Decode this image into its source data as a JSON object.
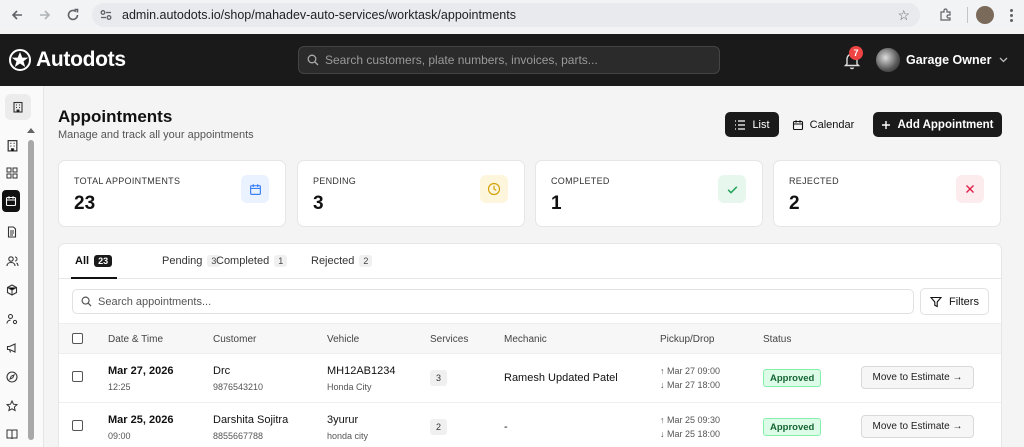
{
  "browser": {
    "url": "admin.autodots.io/shop/mahadev-auto-services/worktask/appointments"
  },
  "header": {
    "brand": "Autodots",
    "search_placeholder": "Search customers, plate numbers, invoices, parts...",
    "notification_count": "7",
    "user_name": "Garage Owner"
  },
  "page": {
    "title": "Appointments",
    "subtitle": "Manage and track all your appointments",
    "view_list": "List",
    "view_calendar": "Calendar",
    "add_button": "Add Appointment"
  },
  "stats": [
    {
      "label": "TOTAL APPOINTMENTS",
      "value": "23",
      "icon": "calendar-icon",
      "color": "#3b82f6",
      "bg": "#eaf2ff"
    },
    {
      "label": "PENDING",
      "value": "3",
      "icon": "clock-icon",
      "color": "#d4a20a",
      "bg": "#fef6dc"
    },
    {
      "label": "COMPLETED",
      "value": "1",
      "icon": "check-icon",
      "color": "#22a55a",
      "bg": "#e8f7ee"
    },
    {
      "label": "REJECTED",
      "value": "2",
      "icon": "x-icon",
      "color": "#e11d48",
      "bg": "#fdecee"
    }
  ],
  "tabs": [
    {
      "label": "All",
      "count": "23"
    },
    {
      "label": "Pending",
      "count": "3"
    },
    {
      "label": "Completed",
      "count": "1"
    },
    {
      "label": "Rejected",
      "count": "2"
    }
  ],
  "table": {
    "search_placeholder": "Search appointments...",
    "filters_label": "Filters",
    "columns": [
      "Date & Time",
      "Customer",
      "Vehicle",
      "Services",
      "Mechanic",
      "Pickup/Drop",
      "Status"
    ],
    "rows": [
      {
        "date": "Mar 27, 2026",
        "time": "12:25",
        "customer": "Drc",
        "phone": "9876543210",
        "plate": "MH12AB1234",
        "model": "Honda City",
        "services": "3",
        "mechanic": "Ramesh Updated Patel",
        "pickup": "↑ Mar 27 09:00",
        "drop": "↓ Mar 27 18:00",
        "status": "Approved",
        "action": "Move to Estimate →"
      },
      {
        "date": "Mar 25, 2026",
        "time": "09:00",
        "customer": "Darshita Sojitra",
        "phone": "8855667788",
        "plate": "3yurur",
        "model": "honda city",
        "services": "2",
        "mechanic": "-",
        "pickup": "↑ Mar 25 09:30",
        "drop": "↓ Mar 25 18:00",
        "status": "Approved",
        "action": "Move to Estimate →"
      }
    ]
  }
}
